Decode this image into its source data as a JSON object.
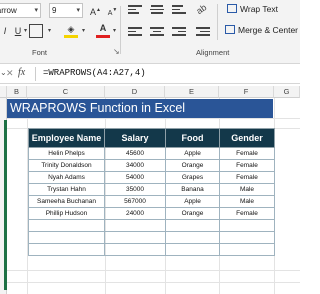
{
  "ribbon": {
    "font_name": "Narrow",
    "font_size": "9",
    "grow_font": "A",
    "shrink_font": "A",
    "italic": "I",
    "underline": "U",
    "font_color_glyph": "A",
    "font_group_label": "Font",
    "alignment_group_label": "Alignment",
    "wrap_text_label": "Wrap Text",
    "merge_center_label": "Merge & Center",
    "colors": {
      "fill": "#f5d400",
      "font_color": "#e02020",
      "brand": "#1e7145"
    }
  },
  "formula_bar": {
    "fx": "fx",
    "formula": "=WRAPROWS(A4:A27,4)"
  },
  "columns": [
    "B",
    "C",
    "D",
    "E",
    "F",
    "G"
  ],
  "title": "WRAPROWS Function in Excel",
  "table": {
    "headers": [
      "Employee Name",
      "Salary",
      "Food",
      "Gender"
    ],
    "rows": [
      [
        "Helin Phelps",
        "45600",
        "Apple",
        "Female"
      ],
      [
        "Trinity Donaldson",
        "34000",
        "Orange",
        "Female"
      ],
      [
        "Nyah Adams",
        "54000",
        "Grapes",
        "Female"
      ],
      [
        "Trystan Hahn",
        "35000",
        "Banana",
        "Male"
      ],
      [
        "Sameeha Buchanan",
        "567000",
        "Apple",
        "Male"
      ],
      [
        "Phillip Hudson",
        "24000",
        "Orange",
        "Female"
      ],
      [
        "",
        "",
        "",
        ""
      ],
      [
        "",
        "",
        "",
        ""
      ],
      [
        "",
        "",
        "",
        ""
      ]
    ]
  }
}
